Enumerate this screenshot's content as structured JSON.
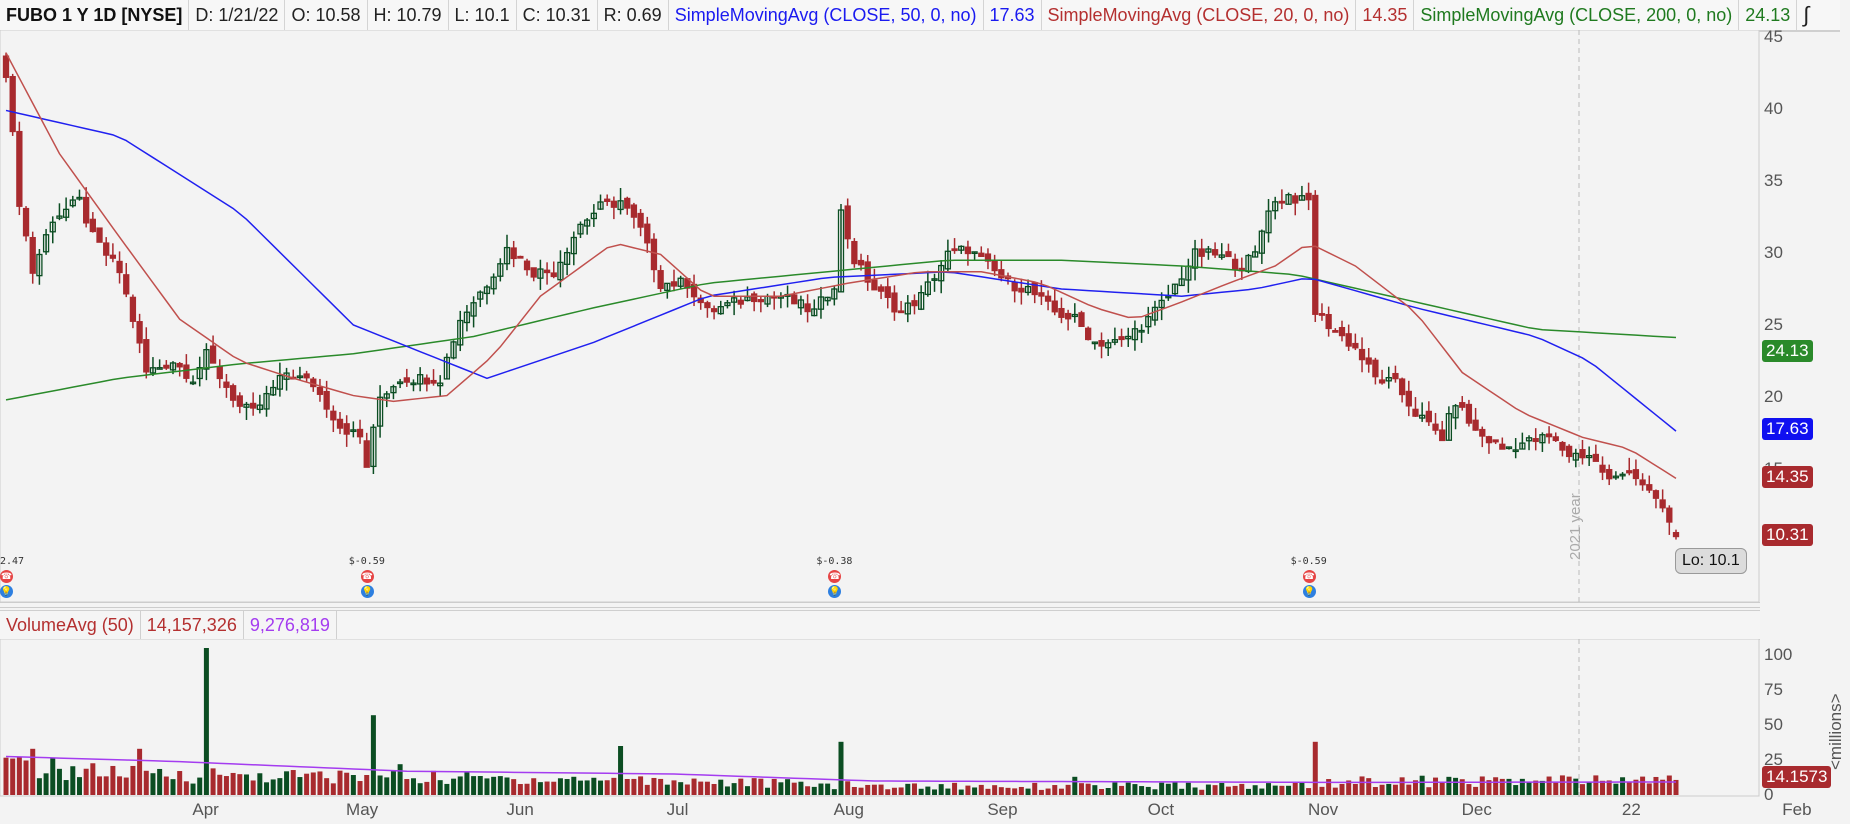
{
  "header": {
    "symbol": "FUBO 1 Y 1D [NYSE]",
    "date": "D: 1/21/22",
    "open": "O: 10.58",
    "high": "H: 10.79",
    "low": "L: 10.1",
    "close": "C: 10.31",
    "range": "R: 0.69",
    "sma50_label": "SimpleMovingAvg (CLOSE, 50, 0, no)",
    "sma50_value": "17.63",
    "sma20_label": "SimpleMovingAvg (CLOSE, 20, 0, no)",
    "sma20_value": "14.35",
    "sma200_label": "SimpleMovingAvg (CLOSE, 200, 0, no)",
    "sma200_value": "24.13"
  },
  "price_tags": {
    "sma200": "24.13",
    "sma50": "17.63",
    "sma20": "14.35",
    "close": "10.31",
    "low_callout": "Lo: 10.1"
  },
  "volume_header": {
    "label": "VolumeAvg (50)",
    "volume": "14,157,326",
    "avg": "9,276,819"
  },
  "volume_tag": "14.1573",
  "volume_unit": "<millions>",
  "year_marker": "2021 year",
  "events": [
    {
      "day": 0,
      "label": "2.47"
    },
    {
      "day": 54,
      "label": "$-0.59"
    },
    {
      "day": 124,
      "label": "$-0.38"
    },
    {
      "day": 195,
      "label": "$-0.59"
    }
  ],
  "colors": {
    "up": "#0b4d22",
    "down": "#a82a2e",
    "sma50": "#2020f0",
    "sma20": "#c0504d",
    "sma200": "#2a8a2a",
    "volavg": "#a43cf0"
  },
  "chart_data": {
    "type": "candlestick",
    "ylim": [
      8,
      45
    ],
    "yticks": [
      10,
      15,
      20,
      25,
      30,
      35,
      40,
      45
    ],
    "xticks": [
      {
        "label": "Apr",
        "day": 30
      },
      {
        "label": "May",
        "day": 53
      },
      {
        "label": "Jun",
        "day": 77
      },
      {
        "label": "Jul",
        "day": 101
      },
      {
        "label": "Aug",
        "day": 126
      },
      {
        "label": "Sep",
        "day": 149
      },
      {
        "label": "Oct",
        "day": 173
      },
      {
        "label": "Nov",
        "day": 197
      },
      {
        "label": "Dec",
        "day": 220
      },
      {
        "label": "22",
        "day": 244
      },
      {
        "label": "Feb",
        "day": 268
      }
    ],
    "close_anchors": [
      [
        0,
        42.6
      ],
      [
        2,
        33.6
      ],
      [
        4,
        28.7
      ],
      [
        7,
        32.4
      ],
      [
        11,
        33.6
      ],
      [
        13,
        31.1
      ],
      [
        17,
        28.7
      ],
      [
        19,
        25.4
      ],
      [
        21,
        21.7
      ],
      [
        25,
        22.5
      ],
      [
        28,
        21.3
      ],
      [
        30,
        22.9
      ],
      [
        35,
        19.3
      ],
      [
        37,
        18.9
      ],
      [
        42,
        21.7
      ],
      [
        46,
        20.9
      ],
      [
        50,
        18
      ],
      [
        53,
        17.2
      ],
      [
        54,
        15.2
      ],
      [
        56,
        20
      ],
      [
        59,
        21.3
      ],
      [
        65,
        21.3
      ],
      [
        68,
        25.4
      ],
      [
        72,
        27.9
      ],
      [
        75,
        30.3
      ],
      [
        79,
        28.7
      ],
      [
        82,
        28.7
      ],
      [
        86,
        32
      ],
      [
        89,
        33.2
      ],
      [
        92,
        33.6
      ],
      [
        95,
        31.6
      ],
      [
        98,
        27.9
      ],
      [
        102,
        27.9
      ],
      [
        105,
        25.9
      ],
      [
        112,
        27
      ],
      [
        116,
        27
      ],
      [
        121,
        25.9
      ],
      [
        124,
        27.9
      ],
      [
        125,
        32.8
      ],
      [
        127,
        29.5
      ],
      [
        130,
        27.5
      ],
      [
        134,
        25.9
      ],
      [
        137,
        27
      ],
      [
        141,
        29.9
      ],
      [
        144,
        30.3
      ],
      [
        150,
        27.9
      ],
      [
        153,
        27.5
      ],
      [
        157,
        25.9
      ],
      [
        160,
        25.4
      ],
      [
        163,
        23.8
      ],
      [
        167,
        23.8
      ],
      [
        171,
        25.4
      ],
      [
        174,
        27
      ],
      [
        178,
        29.9
      ],
      [
        181,
        29.9
      ],
      [
        185,
        29.1
      ],
      [
        187,
        29.9
      ],
      [
        189,
        33.2
      ],
      [
        192,
        34
      ],
      [
        194,
        33.6
      ],
      [
        195,
        33.6
      ],
      [
        196,
        25.9
      ],
      [
        199,
        24.6
      ],
      [
        202,
        23.4
      ],
      [
        205,
        21.3
      ],
      [
        208,
        20.9
      ],
      [
        211,
        18.9
      ],
      [
        215,
        17.2
      ],
      [
        217,
        19.7
      ],
      [
        220,
        17.6
      ],
      [
        224,
        16.4
      ],
      [
        227,
        16.8
      ],
      [
        231,
        17.2
      ],
      [
        234,
        16
      ],
      [
        237,
        16
      ],
      [
        240,
        14.3
      ],
      [
        243,
        14.8
      ],
      [
        246,
        13.5
      ],
      [
        248,
        12.3
      ],
      [
        250,
        10.31
      ]
    ],
    "sma50": [
      [
        0,
        39.9
      ],
      [
        17,
        38.1
      ],
      [
        35,
        32.8
      ],
      [
        52,
        25
      ],
      [
        72,
        21.3
      ],
      [
        88,
        23.8
      ],
      [
        105,
        27
      ],
      [
        123,
        28.3
      ],
      [
        141,
        28.7
      ],
      [
        158,
        27.5
      ],
      [
        176,
        27
      ],
      [
        187,
        27.5
      ],
      [
        195,
        28.3
      ],
      [
        211,
        26.2
      ],
      [
        229,
        24.2
      ],
      [
        237,
        22.5
      ],
      [
        250,
        17.63
      ]
    ],
    "sma20": [
      [
        0,
        43.9
      ],
      [
        8,
        36.9
      ],
      [
        17,
        31.1
      ],
      [
        26,
        25.4
      ],
      [
        35,
        22.5
      ],
      [
        43,
        21.3
      ],
      [
        52,
        20.1
      ],
      [
        58,
        19.7
      ],
      [
        66,
        20.1
      ],
      [
        73,
        22.9
      ],
      [
        80,
        27
      ],
      [
        91,
        30.7
      ],
      [
        98,
        29.9
      ],
      [
        105,
        27
      ],
      [
        116,
        27
      ],
      [
        126,
        27.9
      ],
      [
        137,
        28.7
      ],
      [
        146,
        28.7
      ],
      [
        155,
        27.9
      ],
      [
        163,
        26.2
      ],
      [
        169,
        25.4
      ],
      [
        176,
        26.6
      ],
      [
        183,
        27.9
      ],
      [
        190,
        29.1
      ],
      [
        195,
        30.7
      ],
      [
        202,
        29.1
      ],
      [
        211,
        25.9
      ],
      [
        218,
        21.7
      ],
      [
        227,
        18.9
      ],
      [
        236,
        17.2
      ],
      [
        243,
        16.4
      ],
      [
        250,
        14.35
      ]
    ],
    "sma200": [
      [
        0,
        19.8
      ],
      [
        17,
        21.3
      ],
      [
        35,
        22.3
      ],
      [
        52,
        23
      ],
      [
        70,
        24.2
      ],
      [
        88,
        26.2
      ],
      [
        105,
        27.9
      ],
      [
        123,
        28.7
      ],
      [
        141,
        29.5
      ],
      [
        158,
        29.5
      ],
      [
        176,
        29.1
      ],
      [
        193,
        28.5
      ],
      [
        211,
        26.6
      ],
      [
        229,
        24.7
      ],
      [
        250,
        24.13
      ]
    ],
    "volume": {
      "ylim": [
        0,
        110
      ],
      "yticks": [
        0,
        25,
        50,
        75,
        100
      ],
      "base_anchors": [
        [
          0,
          20
        ],
        [
          20,
          14
        ],
        [
          60,
          12
        ],
        [
          100,
          10
        ],
        [
          130,
          6
        ],
        [
          190,
          6
        ],
        [
          200,
          9
        ],
        [
          250,
          10
        ]
      ],
      "spikes": [
        [
          4,
          33
        ],
        [
          20,
          33
        ],
        [
          30,
          105
        ],
        [
          55,
          57
        ],
        [
          59,
          22
        ],
        [
          92,
          35
        ],
        [
          125,
          38
        ],
        [
          196,
          38
        ],
        [
          160,
          13
        ]
      ],
      "avg_anchors": [
        [
          0,
          27.5
        ],
        [
          25,
          24
        ],
        [
          60,
          17
        ],
        [
          100,
          15
        ],
        [
          130,
          10
        ],
        [
          200,
          9
        ],
        [
          250,
          9.3
        ]
      ]
    }
  }
}
